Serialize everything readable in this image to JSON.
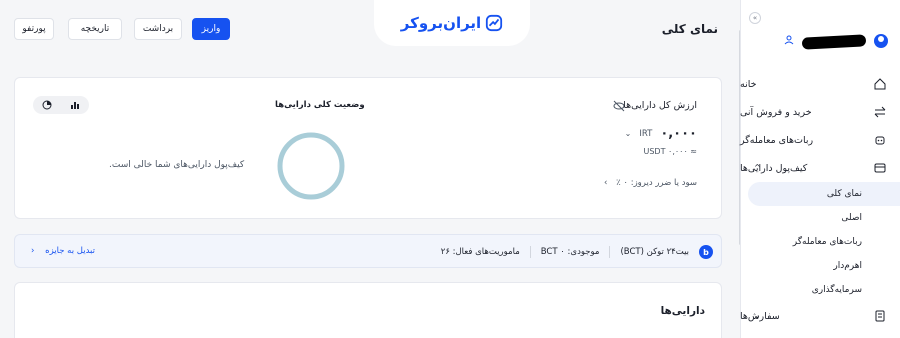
{
  "header": {
    "page_title": "نمای کلی",
    "logo_text": "ایران‌بروکر",
    "buttons": {
      "deposit": "واریز",
      "withdraw": "برداشت",
      "history": "تاریخچه",
      "portfolio": "پورتفو"
    }
  },
  "sidebar": {
    "items": [
      {
        "label": "خانه",
        "icon": "home-icon"
      },
      {
        "label": "خرید و فروش آنی",
        "icon": "swap-icon"
      },
      {
        "label": "ربات‌های معامله‌گر",
        "icon": "robot-icon"
      },
      {
        "label": "کیف‌پول دارایی‌ها",
        "icon": "wallet-icon",
        "chevron": "^"
      },
      {
        "label": "سفارش‌ها",
        "icon": "orders-icon",
        "chevron": "⌄"
      }
    ],
    "wallet_sub": [
      "نمای کلی",
      "اصلی",
      "ربات‌های معامله‌گر",
      "اهرم‌دار",
      "سرمایه‌گذاری"
    ],
    "active_sub": "نمای کلی"
  },
  "overview": {
    "total_title": "ارزش کل دارایی‌ها",
    "irt_amount": "۰,۰۰۰",
    "irt_unit": "IRT",
    "usdt_value": "≈ ۰,۰۰۰ USDT",
    "pnl_label": "سود یا ضرر دیروز: ۰ ٪",
    "status_title": "وضعیت کلی دارایی‌ها",
    "empty_message": "کیف‌پول دارایی‌های شما خالی است."
  },
  "bct": {
    "logo_letter": "b",
    "token_name": "بیت۲۴ توکن (BCT)",
    "balance": "موجودی: ۰ BCT",
    "missions": "ماموریت‌های فعال: ۲۶",
    "reward_link": "تبدیل به جایزه"
  },
  "assets": {
    "title": "دارایی‌ها"
  },
  "colors": {
    "accent": "#1652f0",
    "donut": "#a9cdd8"
  }
}
